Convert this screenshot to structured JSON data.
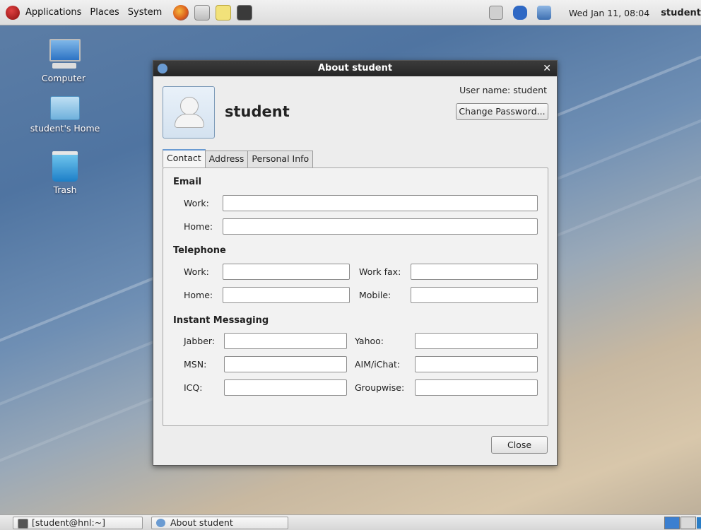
{
  "top_panel": {
    "menus": [
      "Applications",
      "Places",
      "System"
    ],
    "launchers": [
      "firefox-icon",
      "mail-icon",
      "notes-icon",
      "terminal-icon"
    ],
    "tray": [
      "volume-icon",
      "bluetooth-icon",
      "network-icon"
    ],
    "clock": "Wed Jan 11, 08:04",
    "user": "student"
  },
  "desktop": {
    "icons": [
      {
        "label": "Computer",
        "icon": "computer-icon"
      },
      {
        "label": "student's Home",
        "icon": "home-folder-icon"
      },
      {
        "label": "Trash",
        "icon": "trash-icon"
      }
    ]
  },
  "dialog": {
    "title": "About student",
    "display_name": "student",
    "username_label": "User name:  student",
    "change_password": "Change Password...",
    "tabs": [
      "Contact",
      "Address",
      "Personal Info"
    ],
    "active_tab": "Contact",
    "sections": {
      "email": "Email",
      "telephone": "Telephone",
      "im": "Instant Messaging"
    },
    "fields": {
      "email_work": "Work:",
      "email_home": "Home:",
      "tel_work": "Work:",
      "tel_home": "Home:",
      "tel_work_fax": "Work fax:",
      "tel_mobile": "Mobile:",
      "im_jabber": "Jabber:",
      "im_msn": "MSN:",
      "im_icq": "ICQ:",
      "im_yahoo": "Yahoo:",
      "im_aim": "AIM/iChat:",
      "im_groupwise": "Groupwise:"
    },
    "close": "Close"
  },
  "taskbar": {
    "items": [
      "[student@hnl:~]",
      "About student"
    ]
  },
  "colors": {
    "accent": "#6a9bd2",
    "titlebar": "#2e2e2e"
  }
}
